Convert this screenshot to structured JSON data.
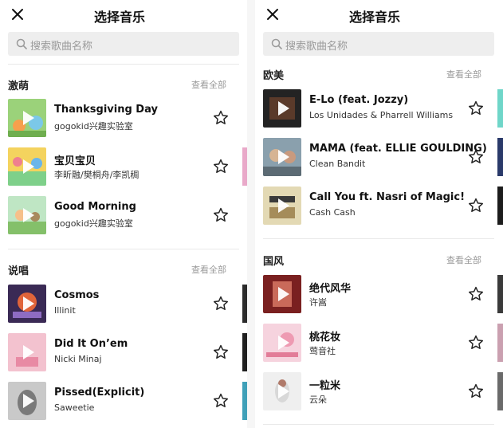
{
  "screens": [
    {
      "title": "选择音乐",
      "search_placeholder": "搜索歌曲名称",
      "sections": [
        {
          "name": "激萌",
          "see_all": "查看全部",
          "songs": [
            {
              "title": "Thanksgiving Day",
              "artist": "gogokid兴趣实验室",
              "cover": "#8ccf6a"
            },
            {
              "title": "宝贝宝贝",
              "artist": "李昕融/樊桐舟/李凯稠",
              "cover": "#f2c94c"
            },
            {
              "title": "Good Morning",
              "artist": "gogokid兴趣实验室",
              "cover": "#8fd0a0"
            }
          ]
        },
        {
          "name": "说唱",
          "see_all": "查看全部",
          "songs": [
            {
              "title": "Cosmos",
              "artist": "Illinit",
              "cover": "#4b3a6e"
            },
            {
              "title": "Did It On’em",
              "artist": "Nicki Minaj",
              "cover": "#f0b9c6"
            },
            {
              "title": "Pissed(Explicit)",
              "artist": "Saweetie",
              "cover": "#9a9a9a"
            }
          ]
        }
      ]
    },
    {
      "title": "选择音乐",
      "search_placeholder": "搜索歌曲名称",
      "sections": [
        {
          "name": "欧美",
          "see_all": "查看全部",
          "songs": [
            {
              "title": "E-Lo (feat. Jozzy)",
              "artist": "Los Unidades & Pharrell Williams",
              "cover": "#2a2a2a"
            },
            {
              "title": "MAMA (feat. ELLIE GOULDING)",
              "artist": "Clean Bandit",
              "cover": "#7a8c9a"
            },
            {
              "title": "Call You ft. Nasri of Magic!",
              "artist": "Cash Cash",
              "cover": "#d9cfa8"
            }
          ]
        },
        {
          "name": "国风",
          "see_all": "查看全部",
          "songs": [
            {
              "title": "绝代风华",
              "artist": "许嵩",
              "cover": "#8a2a2a"
            },
            {
              "title": "桃花妆",
              "artist": "莺音社",
              "cover": "#f3c6d3"
            },
            {
              "title": "一粒米",
              "artist": "云朵",
              "cover": "#e8e8e8"
            }
          ]
        }
      ]
    }
  ]
}
